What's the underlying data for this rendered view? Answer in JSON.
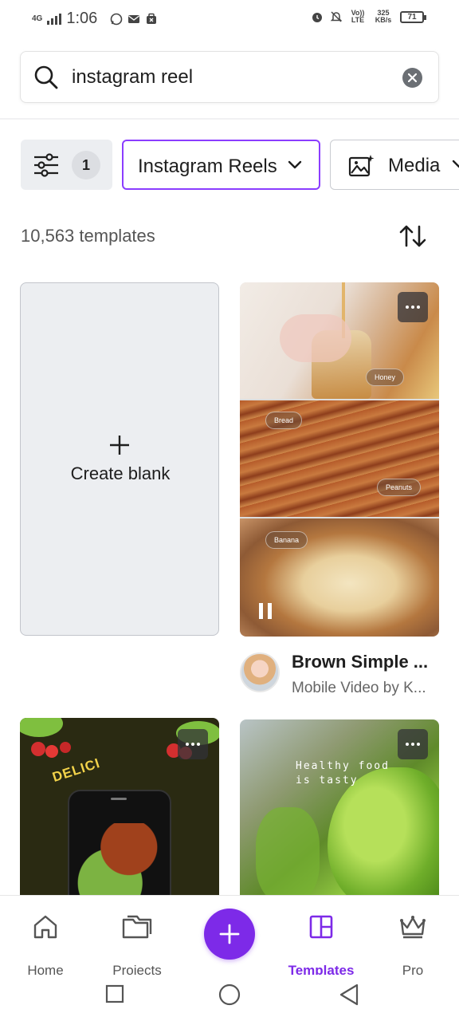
{
  "status_bar": {
    "network": "4G",
    "time": "1:06",
    "volte": "Vo)) LTE",
    "speed": "325 KB/s",
    "battery": "71"
  },
  "search": {
    "query": "instagram reel"
  },
  "filters": {
    "count": "1",
    "category": "Instagram Reels",
    "media": "Media"
  },
  "results": {
    "count_label": "10,563 templates"
  },
  "create_blank": {
    "label": "Create blank"
  },
  "templates": [
    {
      "title": "Brown Simple ...",
      "subtitle": "Mobile Video by K...",
      "tags": [
        "Honey",
        "Bread",
        "Peanuts",
        "Banana"
      ]
    },
    {
      "text": "DELICI"
    },
    {
      "text": "Healthy food is tasty"
    }
  ],
  "bottom_nav": {
    "home": "Home",
    "projects": "Projects",
    "templates": "Templates",
    "pro": "Pro"
  },
  "colors": {
    "accent": "#7d2ae8",
    "chip_border": "#8b3dff"
  }
}
